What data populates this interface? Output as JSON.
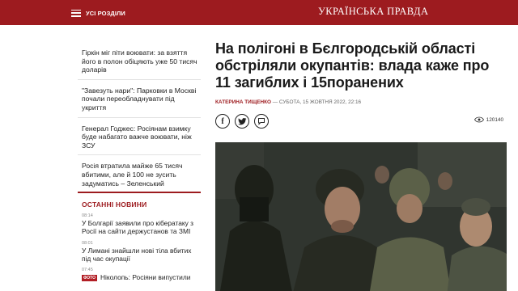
{
  "header": {
    "menu_label": "УСІ РОЗДІЛИ",
    "logo": "УКРАЇНСЬКА ПРАВДА",
    "background_color": "#9d1b1f"
  },
  "sidebar": {
    "items": [
      {
        "text": "Гіркін міг піти воювати: за взяття його в полон обіцяють уже 50 тисяч доларів"
      },
      {
        "text": "\"Завезуть нари\": Парковки в Москві почали переобладнувати під укриття"
      },
      {
        "text": "Генерал Годжес: Росіянам взимку буде набагато важче воювати, ніж ЗСУ"
      },
      {
        "text": "Росія втратила майже 65 тисяч вбитими, але й 100 не зусить задуматись – Зеленський"
      }
    ]
  },
  "latest_news": {
    "title": "ОСТАННІ НОВИНИ",
    "items": [
      {
        "time": "08:14",
        "text": "У Болгарії заявили про кібератаку з Росії на сайти держустанов та ЗМІ"
      },
      {
        "time": "08:01",
        "text": "У Лимані знайшли нові тіла вбитих під час окупації"
      },
      {
        "time": "07:45",
        "badge": "ФОТО",
        "text": "Ніколопь: Росіяни випустили"
      }
    ]
  },
  "article": {
    "headline": "На полігоні в Бєлгородській області обстріляли окупантів: влада каже про 11 загиблих і 15поранених",
    "author": "КАТЕРИНА ТИЩЕНКО",
    "date": " — СУБОТА, 15 ЖОВТНЯ 2022, 22:16",
    "views": "120140",
    "share_icons": [
      "facebook-icon",
      "twitter-icon",
      "comment-icon"
    ]
  }
}
